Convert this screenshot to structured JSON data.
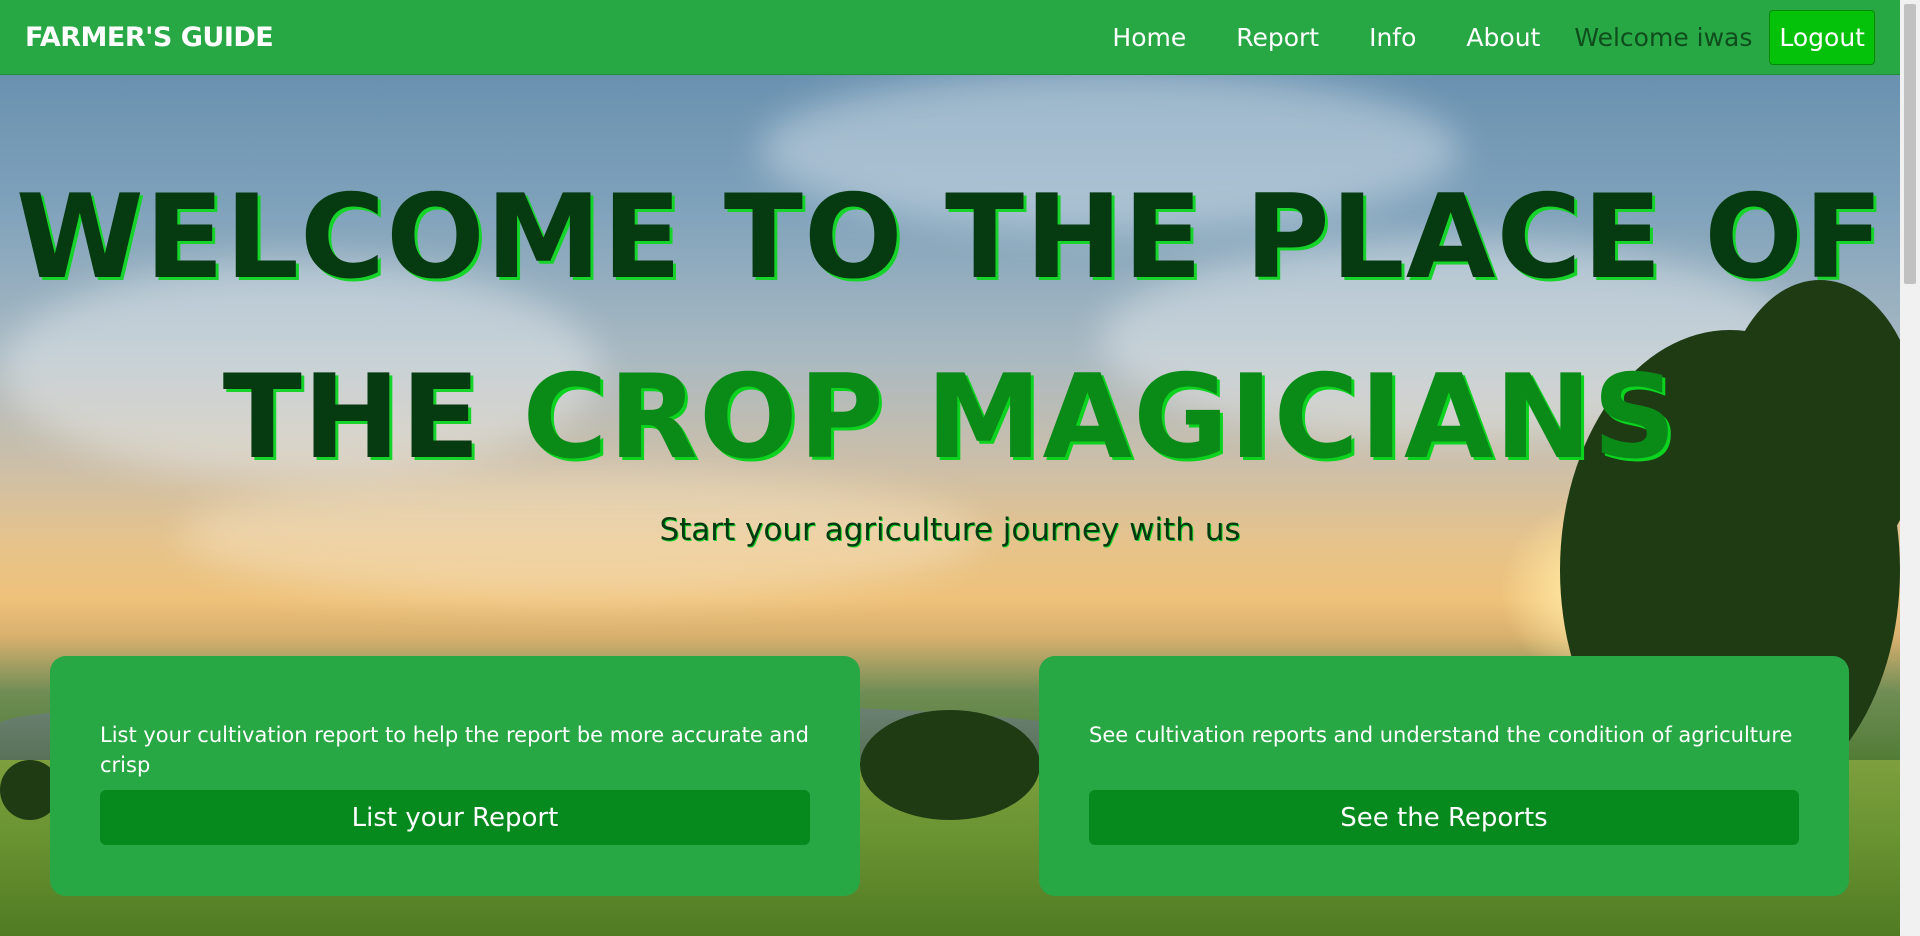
{
  "navbar": {
    "brand": "FARMER'S GUIDE",
    "links": [
      "Home",
      "Report",
      "Info",
      "About"
    ],
    "welcome": "Welcome iwas",
    "logout_label": "Logout"
  },
  "hero": {
    "line1": "WELCOME TO THE PLACE OF",
    "line2_prefix": "THE",
    "line2_accent": "CROP MAGICIANS",
    "subtitle": "Start your agriculture journey with us"
  },
  "cards": [
    {
      "text": "List your cultivation report to help the report be more accurate and crisp",
      "button": "List your Report"
    },
    {
      "text": "See cultivation reports and understand the condition of agriculture",
      "button": "See the Reports"
    }
  ],
  "colors": {
    "navbar": "#28a745",
    "logout": "#04c20a",
    "card": "#28a745",
    "card_button": "#068a1e",
    "heading": "#063a10",
    "accent": "#0a8a17"
  }
}
